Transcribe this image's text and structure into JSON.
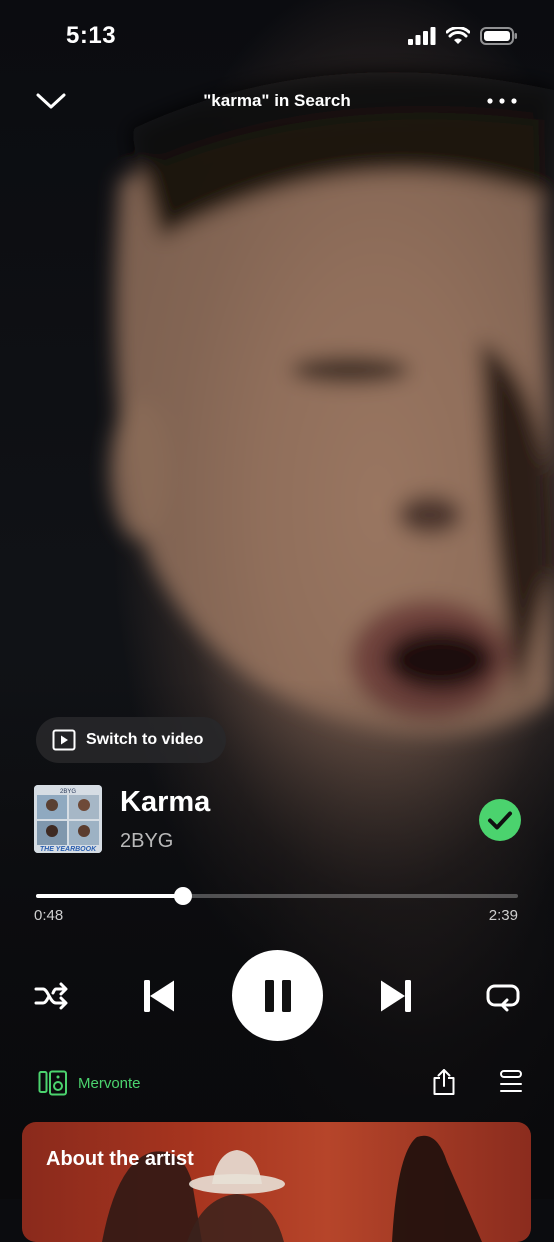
{
  "status": {
    "time": "5:13"
  },
  "header": {
    "context": "\"karma\" in Search"
  },
  "video_toggle": {
    "label": "Switch to video"
  },
  "track": {
    "title": "Karma",
    "artist": "2BYG",
    "saved": true,
    "cover_text_top": "2BYG",
    "cover_text_bottom": "THE YEARBOOK"
  },
  "playback": {
    "elapsed": "0:48",
    "duration": "2:39",
    "progress_fraction": 0.305,
    "state": "playing"
  },
  "device": {
    "name": "Mervonte"
  },
  "about": {
    "title": "About the artist"
  },
  "colors": {
    "accent_green": "#4bd36e",
    "card_red": "#a8351f"
  },
  "icons": [
    "chevron-down-icon",
    "more-icon",
    "video-icon",
    "check-icon",
    "shuffle-icon",
    "previous-icon",
    "pause-icon",
    "next-icon",
    "repeat-icon",
    "speaker-device-icon",
    "share-icon",
    "queue-icon"
  ]
}
